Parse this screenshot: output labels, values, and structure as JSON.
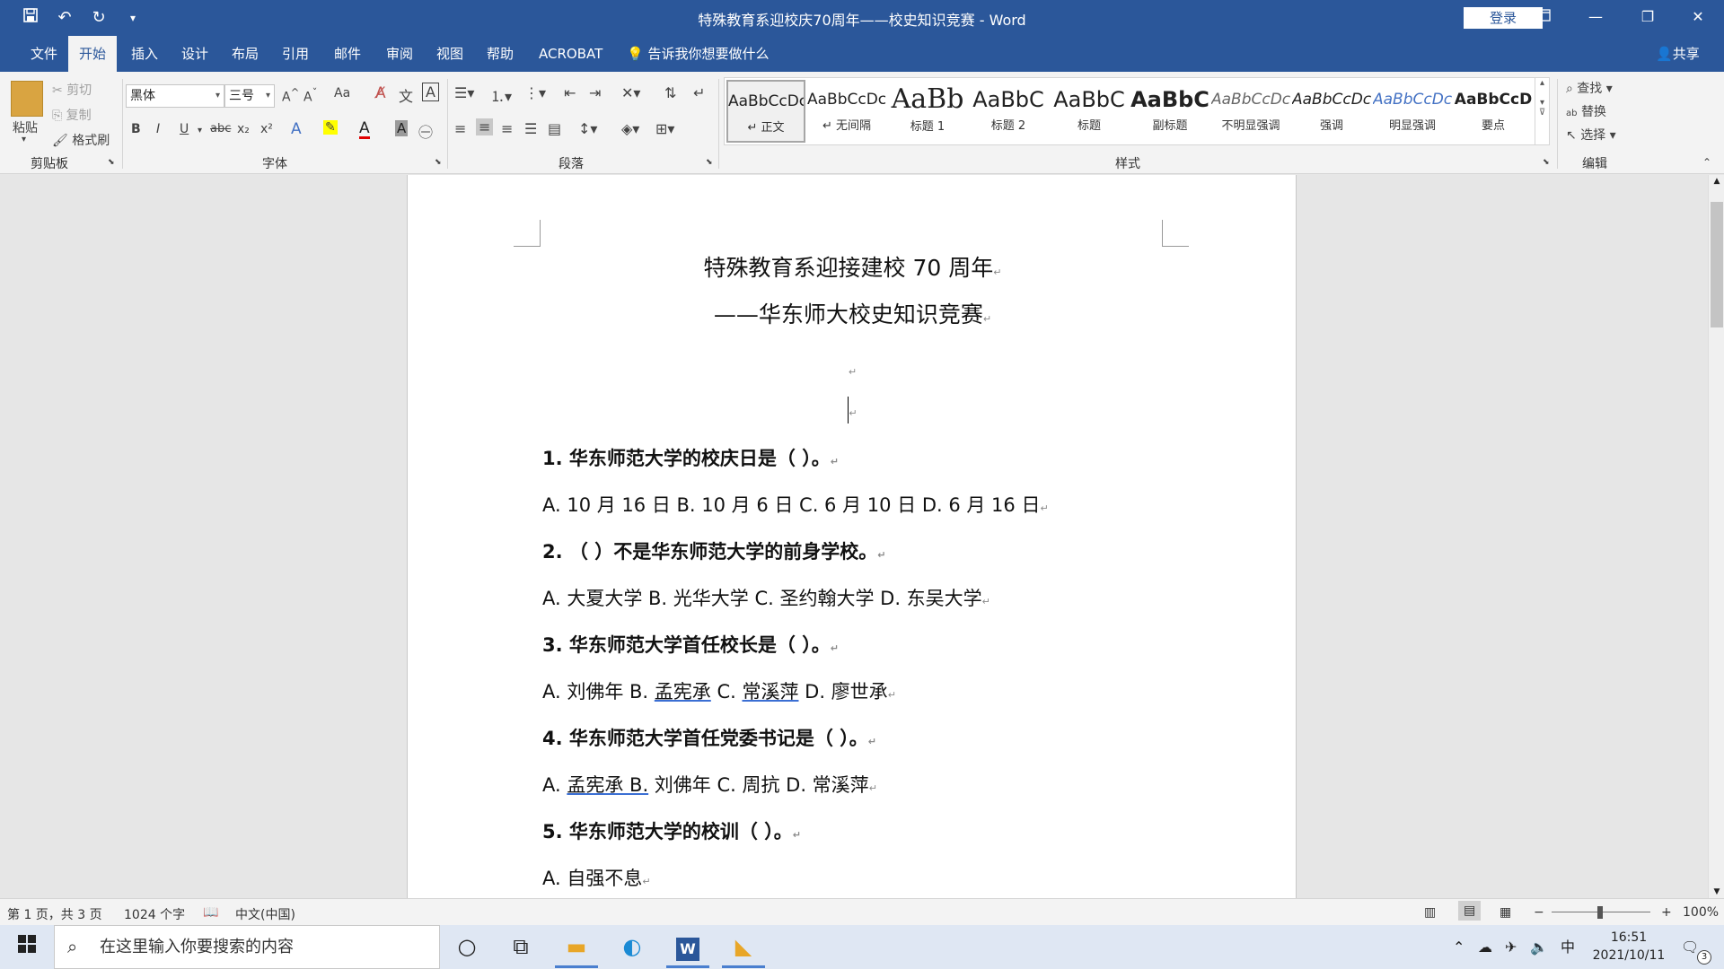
{
  "titlebar": {
    "title": "特殊教育系迎校庆70周年——校史知识竞赛  -  Word",
    "login": "登录",
    "qat": {
      "save_icon": "save-icon",
      "undo_icon": "undo-icon",
      "redo_icon": "redo-icon",
      "customize": "▾"
    }
  },
  "tabs": [
    "文件",
    "开始",
    "插入",
    "设计",
    "布局",
    "引用",
    "邮件",
    "审阅",
    "视图",
    "帮助",
    "ACROBAT"
  ],
  "tellme": "告诉我你想要做什么",
  "share": "共享",
  "ribbon": {
    "clipboard": {
      "paste": "粘贴",
      "cut": "剪切",
      "copy": "复制",
      "format_painter": "格式刷",
      "label": "剪贴板"
    },
    "font": {
      "name": "黑体",
      "size": "三号",
      "label": "字体",
      "bold": "B",
      "italic": "I",
      "underline": "U",
      "strike": "abc",
      "sub": "x₂",
      "sup": "x²",
      "case": "Aa"
    },
    "paragraph": {
      "label": "段落"
    },
    "styles": {
      "label": "样式",
      "items": [
        {
          "preview": "AaBbCcD​c",
          "name": "↵ 正文"
        },
        {
          "preview": "AaBbCcDc",
          "name": "↵ 无间隔"
        },
        {
          "preview": "AaBb",
          "name": "标题 1"
        },
        {
          "preview": "AaBbC",
          "name": "标题 2"
        },
        {
          "preview": "AaBbC",
          "name": "标题"
        },
        {
          "preview": "AaBbC",
          "name": "副标题"
        },
        {
          "preview": "AaBbCcDc",
          "name": "不明显强调"
        },
        {
          "preview": "AaBbCcDc",
          "name": "强调"
        },
        {
          "preview": "AaBbCcDc",
          "name": "明显强调"
        },
        {
          "preview": "AaBbCcD",
          "name": "要点"
        }
      ]
    },
    "editing": {
      "find": "查找",
      "replace": "替换",
      "select": "选择",
      "label": "编辑"
    }
  },
  "document": {
    "title1": "特殊教育系迎接建校 70 周年",
    "title2": "——华东师大校史知识竞赛",
    "q1": "1.  华东师范大学的校庆日是（          ）。",
    "a1": "A.  10 月 16 日    B. 10 月 6 日    C. 6 月 10 日    D. 6 月 16 日",
    "q2": "2. （        ）不是华东师范大学的前身学校。",
    "a2": "A.  大夏大学    B.  光华大学    C.  圣约翰大学    D.  东吴大学",
    "q3": "3.  华东师范大学首任校长是（          ）。",
    "a3_pre": "A.  刘佛年    B.  ",
    "a3_b": "孟宪承",
    "a3_mid": "    C.  ",
    "a3_c": "常溪萍",
    "a3_post": "    D.  廖世承",
    "q4": "4.  华东师范大学首任党委书记是（          ）。",
    "a4_pre": "A.  ",
    "a4_u": "孟宪承    B.",
    "a4_post": "  刘佛年    C.  周抗    D.  常溪萍",
    "q5": "5.  华东师范大学的校训（          ）。",
    "a5": "A.  自强不息",
    "para_mark": "↵"
  },
  "status": {
    "page": "第 1 页，共 3 页",
    "words": "1024 个字",
    "lang": "中文(中国)",
    "zoom": "100%"
  },
  "taskbar": {
    "search": "在这里输入你要搜索的内容",
    "time": "16:51",
    "date": "2021/10/11",
    "ime": "中",
    "notif_count": "3"
  }
}
